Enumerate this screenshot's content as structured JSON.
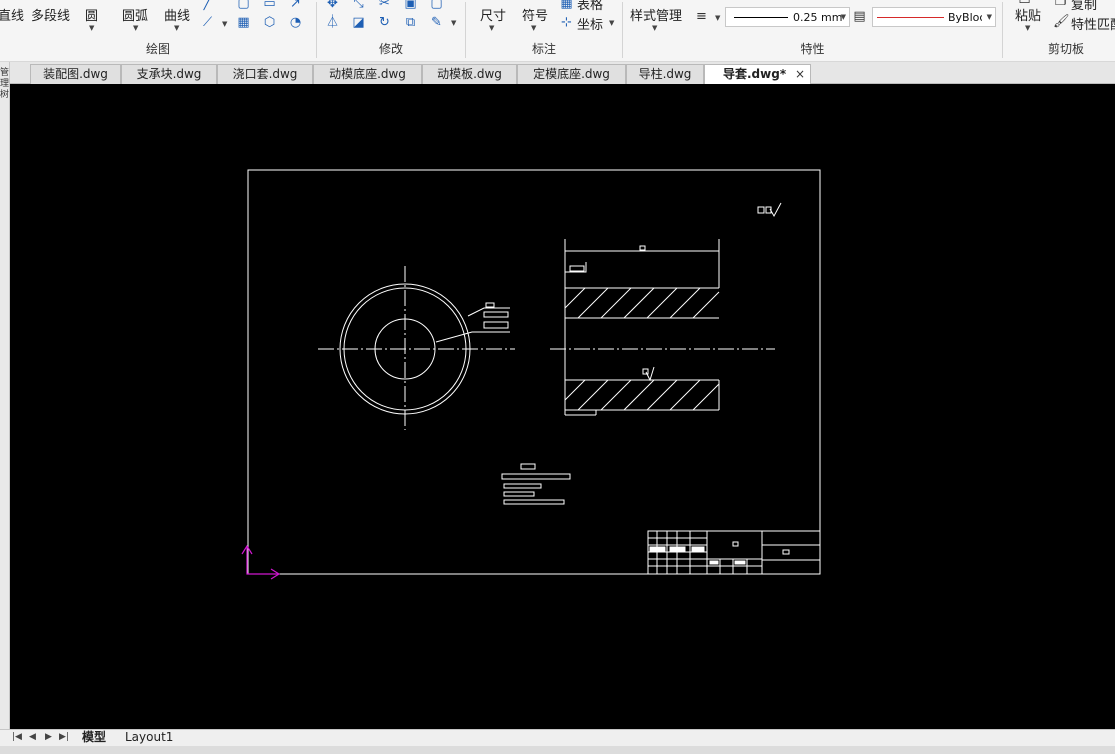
{
  "ribbon": {
    "draw": {
      "line_label": "直线",
      "polyline_label": "多段线",
      "circle_label": "圆",
      "arc_label": "圆弧",
      "curve_label": "曲线",
      "group_label": "绘图"
    },
    "modify": {
      "group_label": "修改"
    },
    "annotate": {
      "dimension_label": "尺寸",
      "symbol_label": "符号",
      "table_label": "表格",
      "coordinate_label": "坐标",
      "group_label": "标注"
    },
    "properties": {
      "style_manager_label": "样式管理",
      "lineweight_value": "0.25 mm",
      "color_value": "ByBlock",
      "group_label": "特性"
    },
    "clipboard": {
      "paste_label": "粘贴",
      "copy_label": "复制",
      "match_properties_label": "特性匹配",
      "group_label": "剪切板"
    }
  },
  "left_strip": {
    "label": "管理树"
  },
  "tabs": [
    {
      "label": "装配图.dwg",
      "active": false
    },
    {
      "label": "支承块.dwg",
      "active": false
    },
    {
      "label": "浇口套.dwg",
      "active": false
    },
    {
      "label": "动模底座.dwg",
      "active": false
    },
    {
      "label": "动模板.dwg",
      "active": false
    },
    {
      "label": "定模底座.dwg",
      "active": false
    },
    {
      "label": "导柱.dwg",
      "active": false
    },
    {
      "label": "导套.dwg*",
      "active": true
    }
  ],
  "tab_close_symbol": "×",
  "layout_tabs": [
    {
      "label": "模型",
      "active": true
    },
    {
      "label": "Layout1",
      "active": false
    }
  ],
  "colors": {
    "canvas_bg": "#000000",
    "drawing_lines": "#ffffff",
    "ucs_icon": "#d016d0",
    "color_swatch_line": "#d62a2a"
  }
}
